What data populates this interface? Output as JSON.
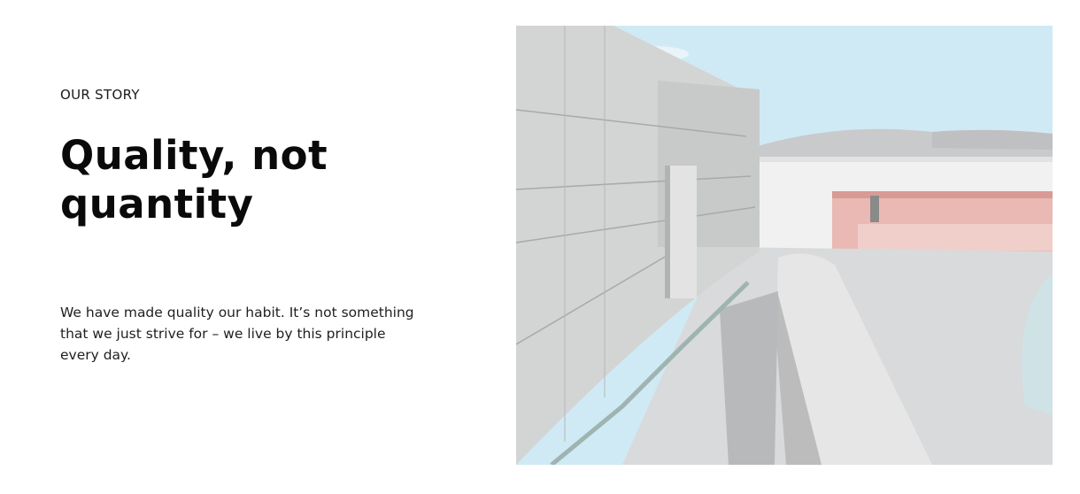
{
  "story": {
    "eyebrow": "OUR STORY",
    "headline_line1": "Quality, not",
    "headline_line2": "quantity",
    "body": "We have made quality our habit. It’s not something that we just strive for – we live by this principle every day."
  },
  "image": {
    "subject": "white-stone-architecture-photo",
    "colors": {
      "sky": "#cfeaf5",
      "wall": "#d4d5d5",
      "accent_pink": "#e9b9b4",
      "pavement": "#d8d9da"
    }
  }
}
